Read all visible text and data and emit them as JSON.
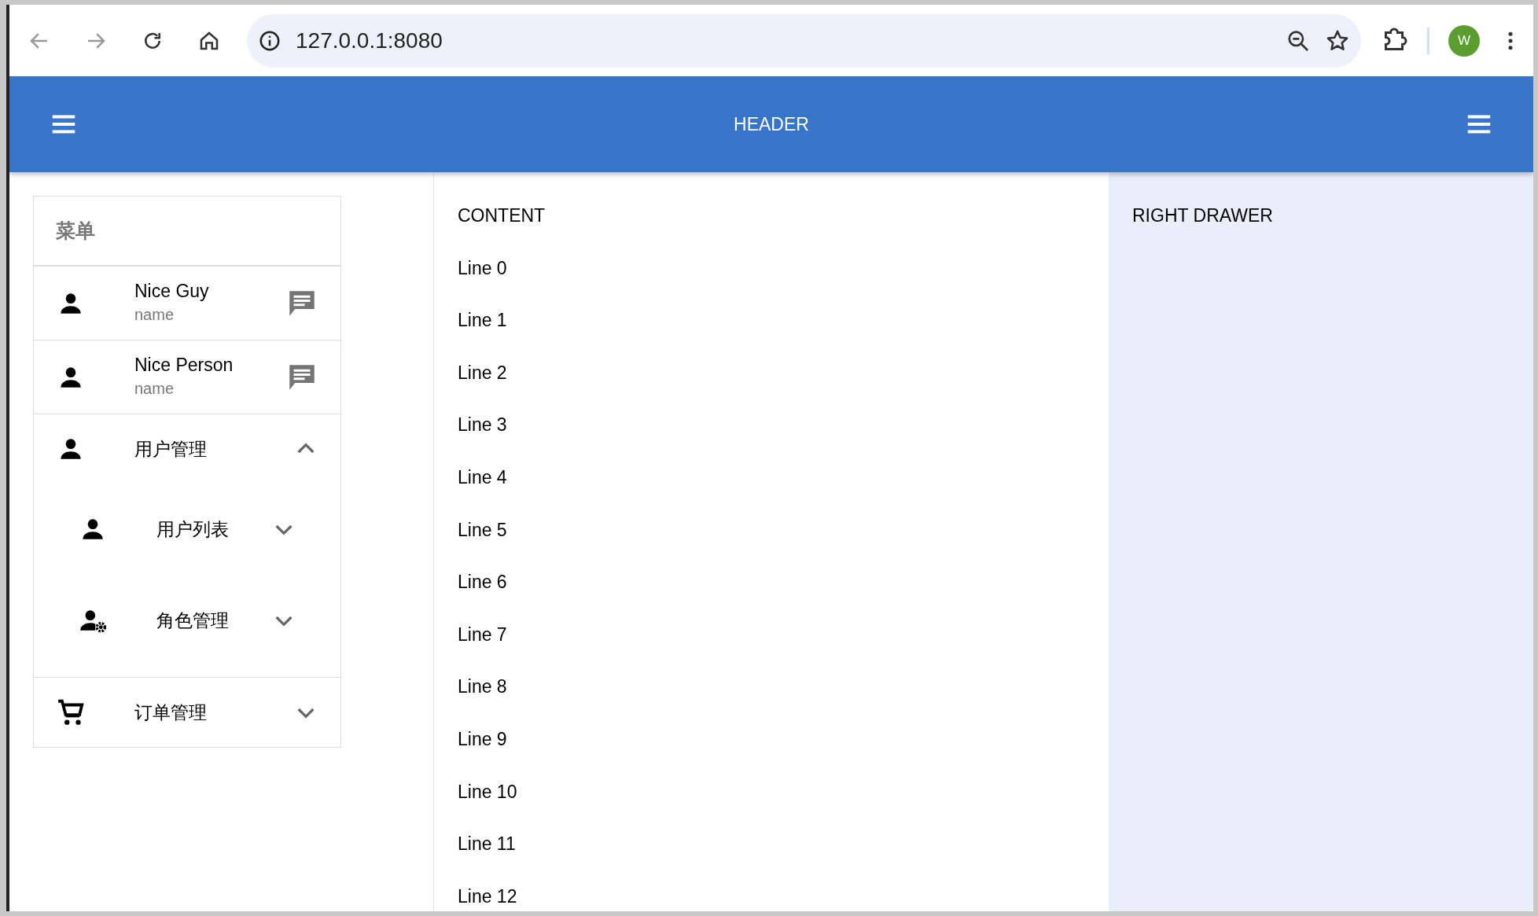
{
  "browser": {
    "url": "127.0.0.1:8080",
    "profile_initial": "W"
  },
  "header": {
    "title": "HEADER"
  },
  "menu": {
    "title": "菜单",
    "items": [
      {
        "kind": "contact",
        "title": "Nice Guy",
        "subtitle": "name"
      },
      {
        "kind": "contact",
        "title": "Nice Person",
        "subtitle": "name"
      },
      {
        "kind": "group",
        "title": "用户管理",
        "expanded": true,
        "children": [
          {
            "title": "用户列表",
            "expanded": false
          },
          {
            "title": "角色管理",
            "expanded": false
          }
        ]
      },
      {
        "kind": "group",
        "title": "订单管理",
        "expanded": false
      }
    ]
  },
  "content": {
    "title": "CONTENT",
    "lines": [
      "Line 0",
      "Line 1",
      "Line 2",
      "Line 3",
      "Line 4",
      "Line 5",
      "Line 6",
      "Line 7",
      "Line 8",
      "Line 9",
      "Line 10",
      "Line 11",
      "Line 12"
    ]
  },
  "right_drawer": {
    "title": "RIGHT DRAWER"
  }
}
